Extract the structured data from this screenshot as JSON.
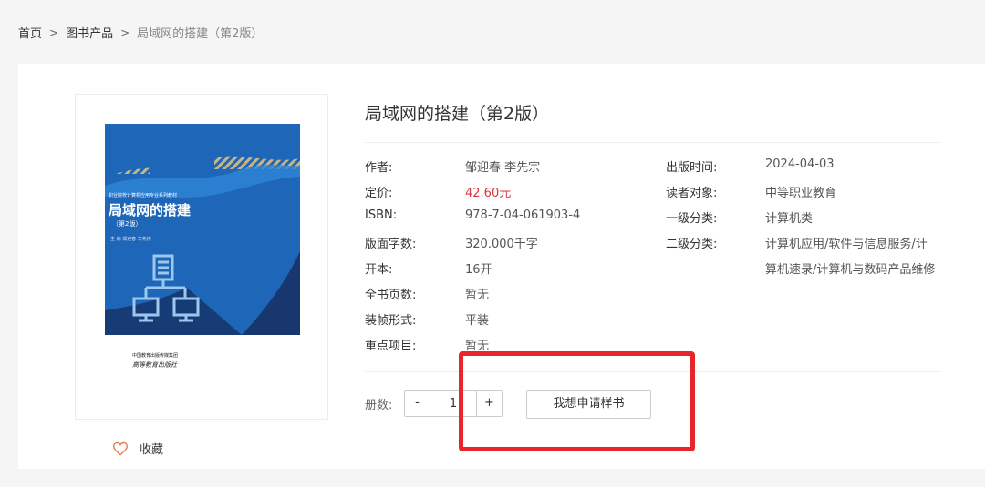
{
  "breadcrumb": {
    "home": "首页",
    "category": "图书产品",
    "current": "局域网的搭建（第2版）",
    "separator": ">"
  },
  "cover": {
    "series": "职业院校计算机应用专业系列教材",
    "title": "局域网的搭建",
    "edition": "（第2版）",
    "authors": "主 编  邹迎春    李先宗",
    "publisher": "中国教育出版传媒集团",
    "publisher_calligraphy": "高等教育出版社",
    "colors": {
      "blue": "#1d66b8",
      "dark_blue": "#17376e",
      "light_blue": "#2f86d6",
      "stripe": "#c9b583"
    }
  },
  "favorite": {
    "icon": "heart-icon",
    "label": "收藏"
  },
  "book": {
    "title": "局域网的搭建（第2版）",
    "left_fields": [
      {
        "label": "作者:",
        "value": "邹迎春  李先宗"
      },
      {
        "label": "定价:",
        "value": "42.60元"
      },
      {
        "label": "ISBN:",
        "value": "978-7-04-061903-4"
      },
      {
        "label": "版面字数:",
        "value": "320.000千字"
      },
      {
        "label": "开本:",
        "value": "16开"
      },
      {
        "label": "全书页数:",
        "value": "暂无"
      },
      {
        "label": "装帧形式:",
        "value": "平装"
      },
      {
        "label": "重点项目:",
        "value": "暂无"
      }
    ],
    "right_fields": [
      {
        "label": "出版时间:",
        "value": "2024-04-03"
      },
      {
        "label": "读者对象:",
        "value": "中等职业教育"
      },
      {
        "label": "一级分类:",
        "value": "计算机类"
      },
      {
        "label": "二级分类:",
        "value": "计算机应用/软件与信息服务/计",
        "value2": "算机速录/计算机与数码产品维修"
      }
    ]
  },
  "purchase": {
    "qty_label": "册数:",
    "minus": "-",
    "plus": "+",
    "qty_value": "1",
    "apply_button": "我想申请样书"
  },
  "colors": {
    "price": "#d9363e",
    "highlight": "#e8262a"
  }
}
